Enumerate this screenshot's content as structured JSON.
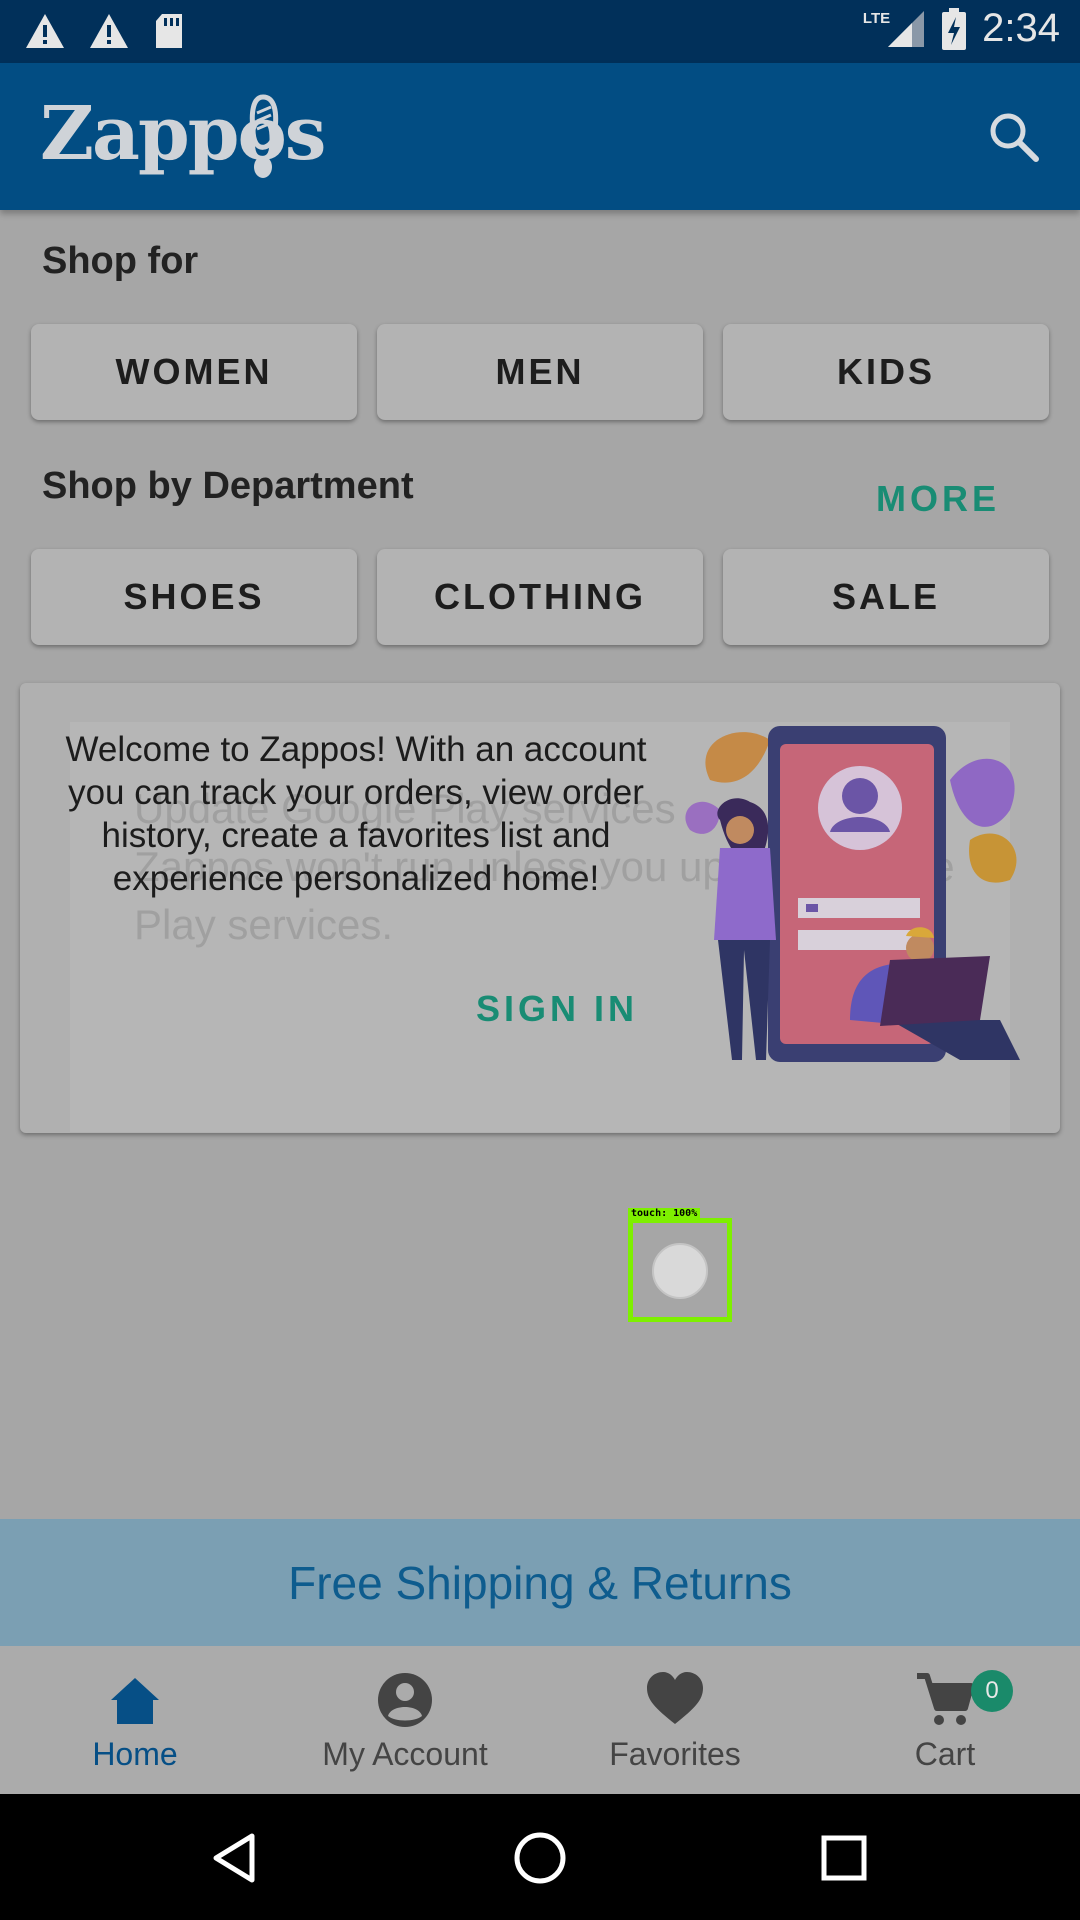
{
  "status_bar": {
    "time": "2:34",
    "network": "LTE",
    "icons": [
      "warning-icon",
      "warning-icon",
      "sd-card-icon",
      "signal-icon",
      "battery-charging-icon"
    ]
  },
  "app_bar": {
    "logo_text": "Zappos",
    "search_icon": "search-icon"
  },
  "shop_for": {
    "title": "Shop for",
    "buttons": [
      "WOMEN",
      "MEN",
      "KIDS"
    ]
  },
  "department": {
    "title": "Shop by Department",
    "more_label": "MORE",
    "buttons": [
      "SHOES",
      "CLOTHING",
      "SALE"
    ]
  },
  "welcome_card": {
    "message": "Welcome to Zappos! With an account you can track your orders, view order history, create a favorites list and experience personalized home!",
    "sign_in_label": "SIGN IN",
    "background_dialog_text": "Update Google Play services\nZappos won't run unless you update Google Play services."
  },
  "touch_indicator": {
    "label": "touch: 100%"
  },
  "shipping_banner": {
    "text": "Free Shipping & Returns"
  },
  "bottom_nav": {
    "items": [
      {
        "label": "Home",
        "icon": "home-icon",
        "active": true
      },
      {
        "label": "My Account",
        "icon": "account-icon",
        "active": false
      },
      {
        "label": "Favorites",
        "icon": "heart-icon",
        "active": false
      },
      {
        "label": "Cart",
        "icon": "cart-icon",
        "active": false
      }
    ],
    "cart_count": "0"
  },
  "colors": {
    "app_bar": "#024d83",
    "status_bar": "#01305a",
    "accent_green": "#198c74",
    "banner": "#7b9fb3",
    "active_nav": "#064f86"
  }
}
